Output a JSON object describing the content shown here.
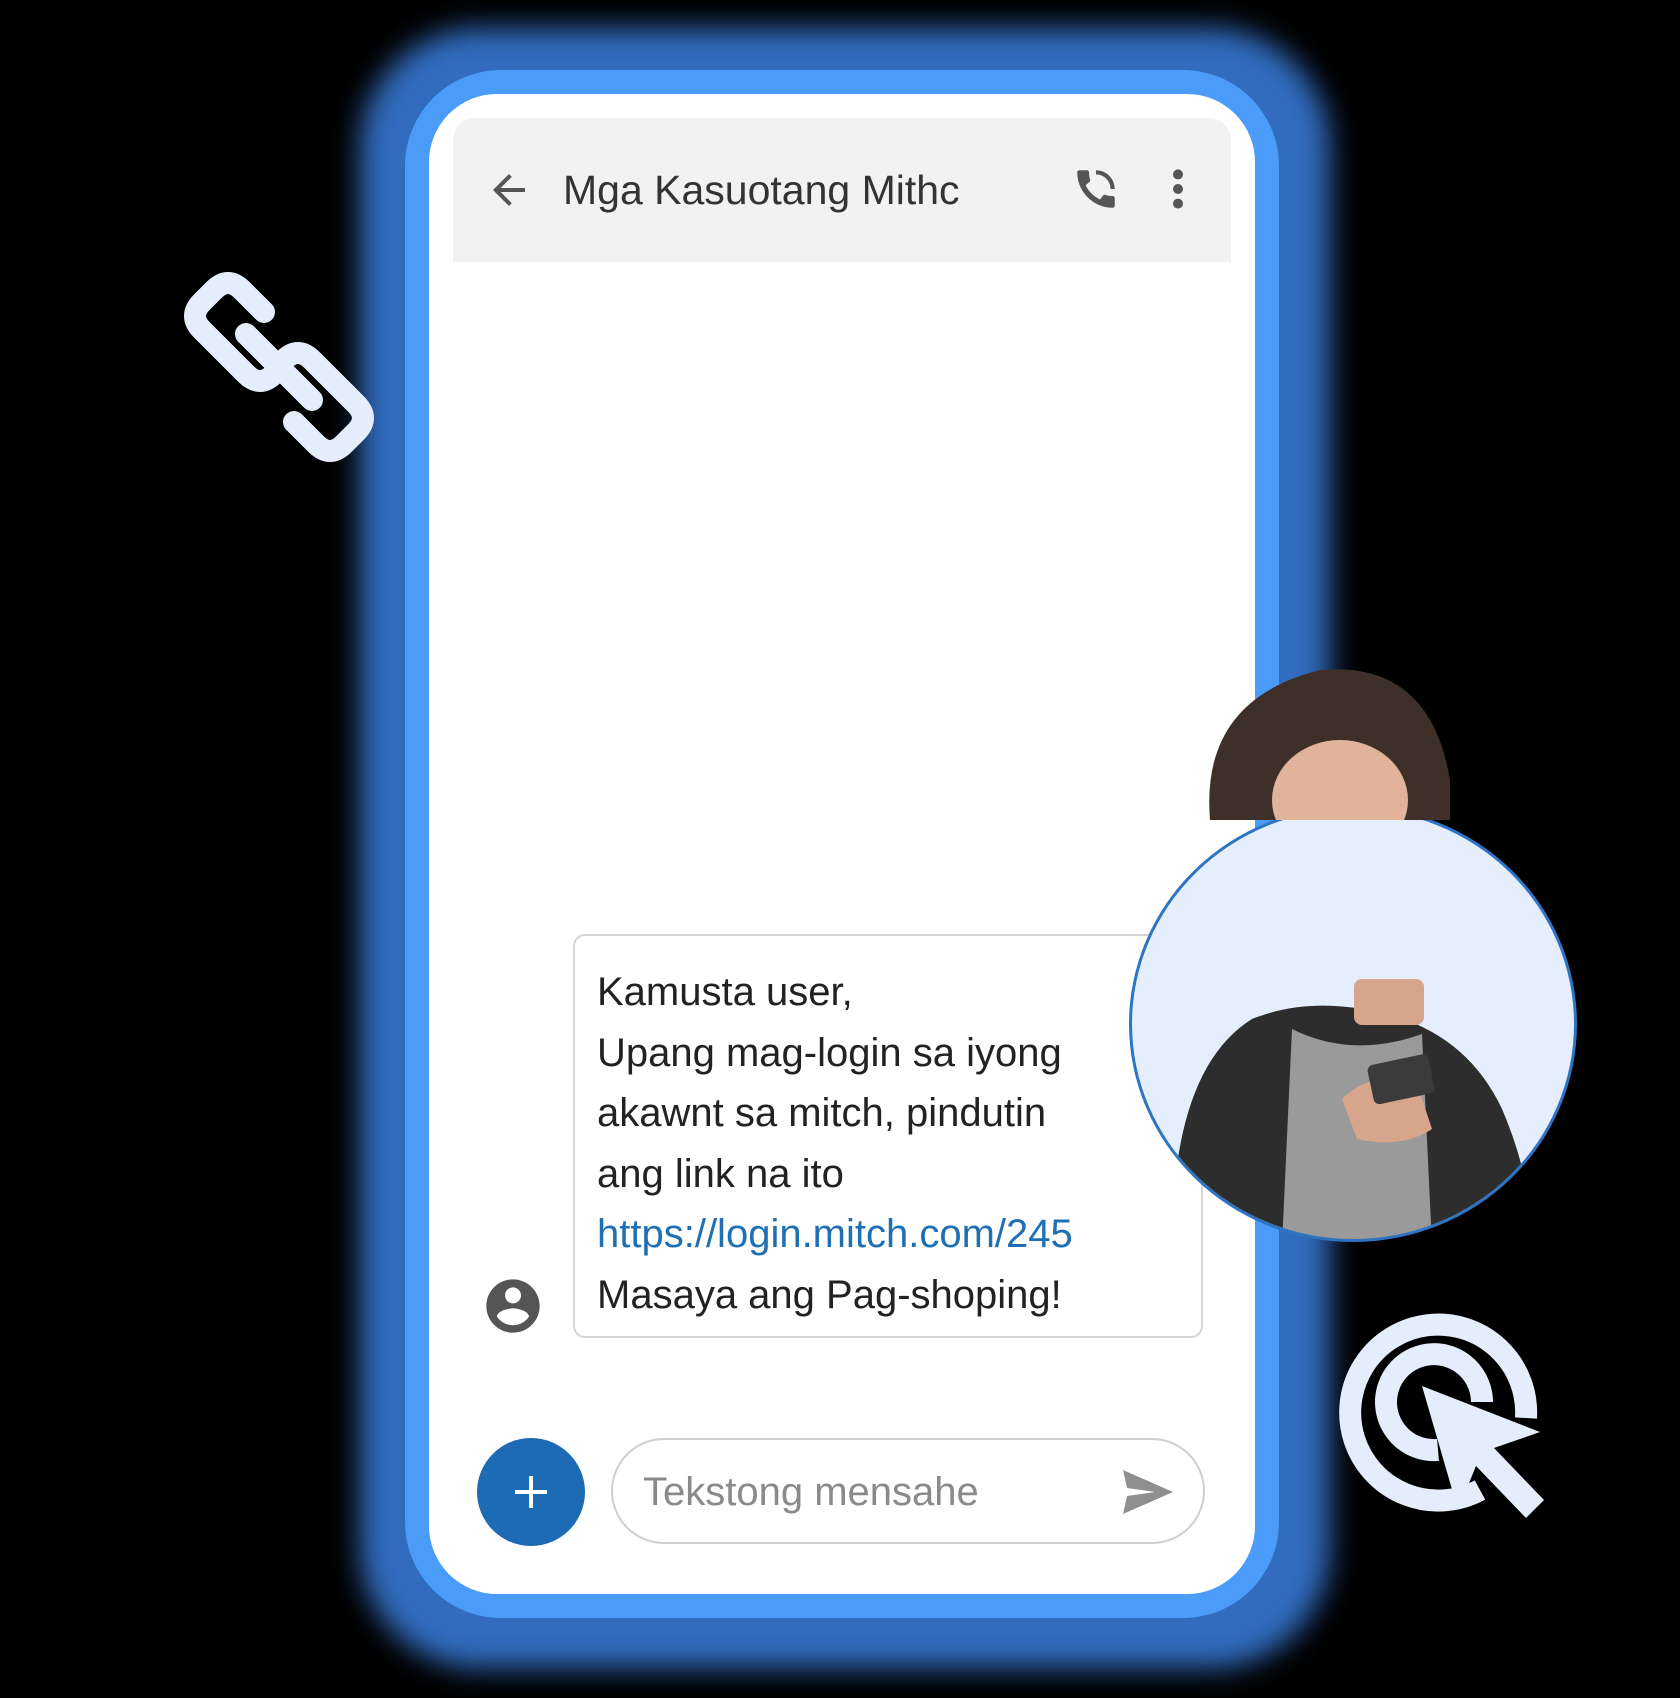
{
  "header": {
    "title": "Mga Kasuotang Mithc",
    "back_icon": "arrow-left-icon",
    "call_icon": "phone-icon",
    "more_icon": "more-vert-icon"
  },
  "message": {
    "sender_icon": "account-circle-icon",
    "lines": [
      "Kamusta user,",
      "Upang mag-login sa iyong",
      "akawnt sa mitch, pindutin",
      "ang link na ito"
    ],
    "link": "https://login.mitch.com/245",
    "closing": "Masaya ang Pag-shoping!"
  },
  "composer": {
    "add_icon": "plus-icon",
    "placeholder": "Tekstong mensahe",
    "value": "",
    "send_icon": "send-icon"
  },
  "decorations": {
    "link_icon": "chain-link-icon",
    "click_icon": "click-target-icon",
    "photo": "woman-using-phone-photo"
  },
  "colors": {
    "phone_frame": "#4a9cf8",
    "accent": "#1c6bb4",
    "link": "#1f6fb4",
    "header_bg": "#f2f2f2",
    "decor_light": "#e3edfc"
  }
}
